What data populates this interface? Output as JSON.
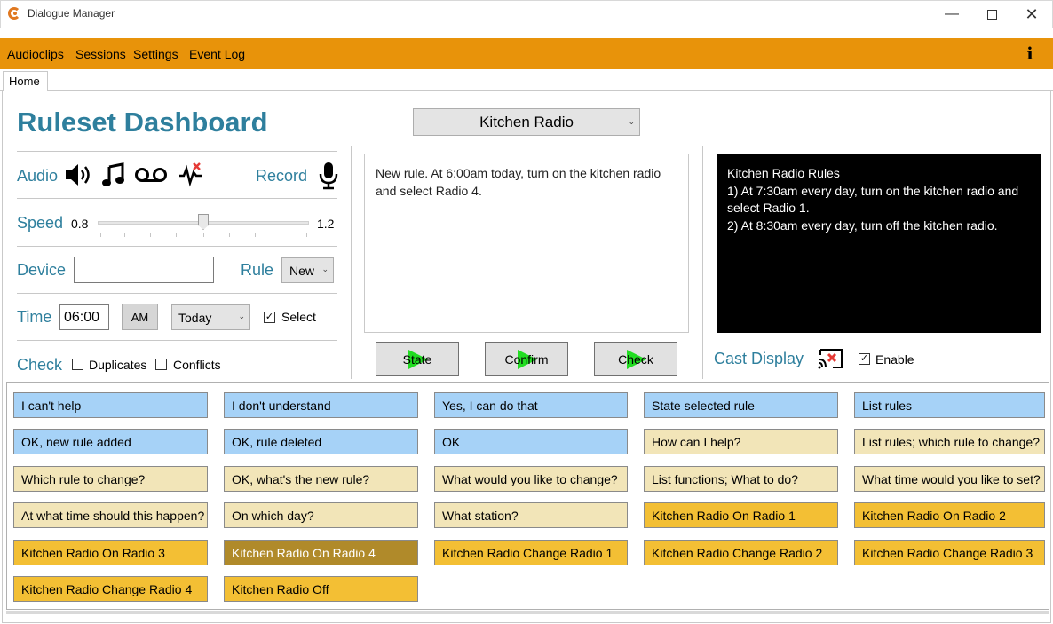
{
  "window": {
    "title": "Dialogue Manager"
  },
  "menu": {
    "items": [
      "Audioclips",
      "Sessions",
      "Settings",
      "Event Log"
    ],
    "info_icon": "info-icon"
  },
  "tabs": {
    "home": "Home"
  },
  "dashboard": {
    "heading": "Ruleset Dashboard",
    "device_select": "Kitchen Radio",
    "audio": {
      "label": "Audio",
      "record_label": "Record"
    },
    "speed": {
      "label": "Speed",
      "min": "0.8",
      "max": "1.2",
      "value": 1.0
    },
    "device": {
      "label": "Device",
      "value": ""
    },
    "rule": {
      "label": "Rule",
      "value": "New"
    },
    "time": {
      "label": "Time",
      "value": "06:00",
      "ampm": "AM",
      "day": "Today",
      "select_label": "Select",
      "select_checked": true
    },
    "check": {
      "label": "Check",
      "duplicates": "Duplicates",
      "conflicts": "Conflicts"
    },
    "rule_text": "New rule. At 6:00am today, turn on the kitchen radio and select Radio 4.",
    "actions": [
      "State",
      "Confirm",
      "Check"
    ],
    "rules_display": {
      "lines": [
        "Kitchen Radio Rules",
        "1) At 7:30am every day, turn on the kitchen radio and select Radio 1.",
        "2) At 8:30am every day, turn off the kitchen radio."
      ]
    },
    "cast": {
      "label": "Cast Display",
      "enable_label": "Enable",
      "enabled": true
    }
  },
  "phrases": [
    [
      {
        "t": "I can't help",
        "c": "blue"
      },
      {
        "t": "I don't understand",
        "c": "blue"
      },
      {
        "t": "Yes, I can do that",
        "c": "blue"
      },
      {
        "t": "State selected rule",
        "c": "blue"
      },
      {
        "t": "List rules",
        "c": "blue"
      }
    ],
    [
      {
        "t": "OK, new rule added",
        "c": "blue"
      },
      {
        "t": "OK, rule deleted",
        "c": "blue"
      },
      {
        "t": "OK",
        "c": "blue"
      },
      {
        "t": "How can I help?",
        "c": "beige"
      },
      {
        "t": "List rules; which rule to change?",
        "c": "beige"
      }
    ],
    [
      {
        "t": "Which rule to change?",
        "c": "beige"
      },
      {
        "t": "OK, what's the new rule?",
        "c": "beige"
      },
      {
        "t": "What would you like to change?",
        "c": "beige"
      },
      {
        "t": "List functions; What to do?",
        "c": "beige"
      },
      {
        "t": "What time would you like to set?",
        "c": "beige"
      }
    ],
    [
      {
        "t": "At what time should this happen?",
        "c": "beige"
      },
      {
        "t": "On which day?",
        "c": "beige"
      },
      {
        "t": "What station?",
        "c": "beige"
      },
      {
        "t": "Kitchen Radio On Radio 1",
        "c": "gold"
      },
      {
        "t": "Kitchen Radio On Radio 2",
        "c": "gold"
      }
    ],
    [
      {
        "t": "Kitchen Radio On Radio 3",
        "c": "gold"
      },
      {
        "t": "Kitchen Radio On Radio 4",
        "c": "dark"
      },
      {
        "t": "Kitchen Radio Change Radio 1",
        "c": "gold"
      },
      {
        "t": "Kitchen Radio Change Radio 2",
        "c": "gold"
      },
      {
        "t": "Kitchen Radio Change Radio 3",
        "c": "gold"
      }
    ],
    [
      {
        "t": "Kitchen Radio Change Radio 4",
        "c": "gold"
      },
      {
        "t": "Kitchen Radio Off",
        "c": "gold"
      }
    ]
  ]
}
